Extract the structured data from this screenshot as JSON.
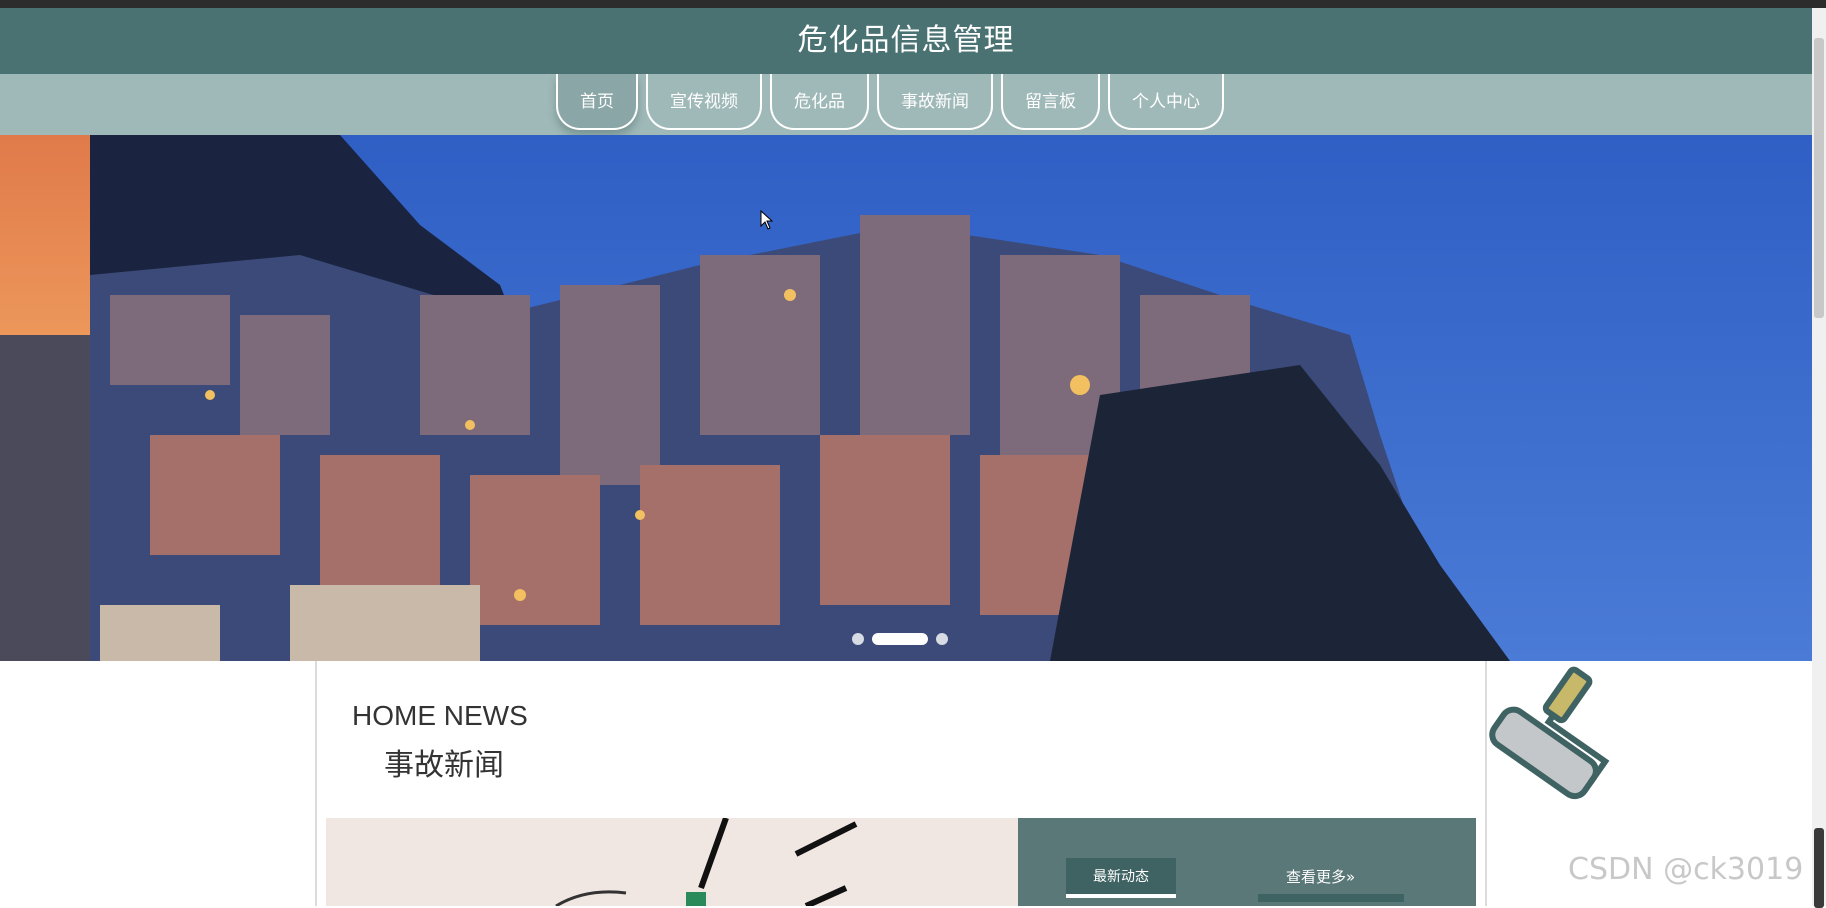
{
  "header": {
    "title": "危化品信息管理"
  },
  "nav": {
    "items": [
      {
        "label": "首页"
      },
      {
        "label": "宣传视频"
      },
      {
        "label": "危化品"
      },
      {
        "label": "事故新闻"
      },
      {
        "label": "留言板"
      },
      {
        "label": "个人中心"
      }
    ],
    "active_index": 0
  },
  "banner": {
    "slides_count": 3,
    "active_slide": 1
  },
  "news_section": {
    "title_en": "HOME NEWS",
    "title_cn": "事故新闻",
    "tab_latest": "最新动态",
    "more_link": "查看更多»"
  },
  "watermark": "CSDN @ck3019",
  "colors": {
    "header_bg": "#4a7272",
    "nav_bg": "#9fb8b8",
    "panel_bg": "#5a7878"
  }
}
